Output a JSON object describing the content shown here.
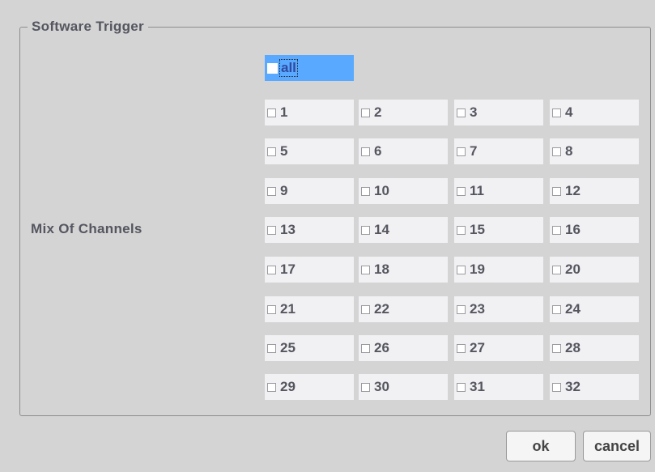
{
  "dialog": {
    "group_title": "Software Trigger",
    "mix_label": "Mix Of Channels",
    "all_label": "all",
    "channels": [
      "1",
      "2",
      "3",
      "4",
      "5",
      "6",
      "7",
      "8",
      "9",
      "10",
      "11",
      "12",
      "13",
      "14",
      "15",
      "16",
      "17",
      "18",
      "19",
      "20",
      "21",
      "22",
      "23",
      "24",
      "25",
      "26",
      "27",
      "28",
      "29",
      "30",
      "31",
      "32"
    ],
    "ok_label": "ok",
    "cancel_label": "cancel"
  }
}
